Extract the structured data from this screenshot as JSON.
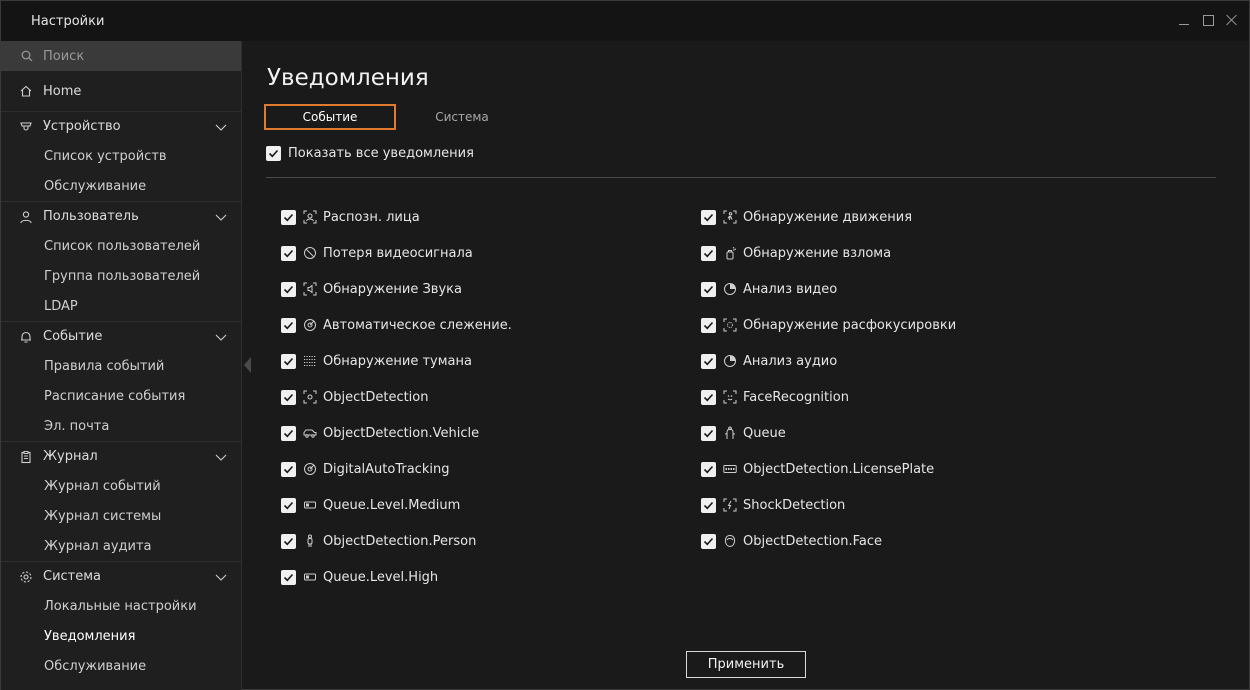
{
  "window": {
    "title": "Настройки"
  },
  "colors": {
    "accent": "#e07a2f",
    "background": "#1a1a1a",
    "sidebar": "#1f1f1f",
    "search_bg": "#3a3a3a"
  },
  "sidebar": {
    "search_placeholder": "Поиск",
    "home": "Home",
    "groups": [
      {
        "label": "Устройство",
        "icon": "camera-icon",
        "items": [
          "Список устройств",
          "Обслуживание"
        ]
      },
      {
        "label": "Пользователь",
        "icon": "user-icon",
        "items": [
          "Список пользователей",
          "Группа пользователей",
          "LDAP"
        ]
      },
      {
        "label": "Событие",
        "icon": "bell-icon",
        "items": [
          "Правила событий",
          "Расписание события",
          "Эл. почта"
        ]
      },
      {
        "label": "Журнал",
        "icon": "clipboard-icon",
        "items": [
          "Журнал событий",
          "Журнал системы",
          "Журнал аудита"
        ]
      },
      {
        "label": "Система",
        "icon": "gear-icon",
        "items": [
          "Локальные настройки",
          "Уведомления",
          "Обслуживание"
        ]
      }
    ],
    "active_item": "Уведомления"
  },
  "main": {
    "title": "Уведомления",
    "tabs": [
      {
        "label": "Событие",
        "active": true
      },
      {
        "label": "Система",
        "active": false
      }
    ],
    "show_all_label": "Показать все уведомления",
    "show_all_checked": true,
    "events_left": [
      {
        "label": "Распозн. лица",
        "icon": "face-icon",
        "checked": true
      },
      {
        "label": "Потеря видеосигнала",
        "icon": "no-signal-icon",
        "checked": true
      },
      {
        "label": "Обнаружение Звука",
        "icon": "sound-icon",
        "checked": true
      },
      {
        "label": "Автоматическое слежение.",
        "icon": "tracking-icon",
        "checked": true
      },
      {
        "label": "Обнаружение тумана",
        "icon": "fog-icon",
        "checked": true
      },
      {
        "label": "ObjectDetection",
        "icon": "object-icon",
        "checked": true
      },
      {
        "label": "ObjectDetection.Vehicle",
        "icon": "vehicle-icon",
        "checked": true
      },
      {
        "label": "DigitalAutoTracking",
        "icon": "tracking-icon",
        "checked": true
      },
      {
        "label": "Queue.Level.Medium",
        "icon": "queue-level-icon",
        "checked": true
      },
      {
        "label": "ObjectDetection.Person",
        "icon": "person-icon",
        "checked": true
      },
      {
        "label": "Queue.Level.High",
        "icon": "queue-level-icon",
        "checked": true
      }
    ],
    "events_right": [
      {
        "label": "Обнаружение движения",
        "icon": "motion-icon",
        "checked": true
      },
      {
        "label": "Обнаружение взлома",
        "icon": "tamper-icon",
        "checked": true
      },
      {
        "label": "Анализ видео",
        "icon": "video-analysis-icon",
        "checked": true
      },
      {
        "label": "Обнаружение расфокусировки",
        "icon": "defocus-icon",
        "checked": true
      },
      {
        "label": "Анализ аудио",
        "icon": "audio-analysis-icon",
        "checked": true
      },
      {
        "label": "FaceRecognition",
        "icon": "face-recognition-icon",
        "checked": true
      },
      {
        "label": "Queue",
        "icon": "queue-icon",
        "checked": true
      },
      {
        "label": "ObjectDetection.LicensePlate",
        "icon": "license-plate-icon",
        "checked": true
      },
      {
        "label": "ShockDetection",
        "icon": "shock-icon",
        "checked": true
      },
      {
        "label": "ObjectDetection.Face",
        "icon": "face-outline-icon",
        "checked": true
      }
    ],
    "apply_label": "Применить"
  }
}
